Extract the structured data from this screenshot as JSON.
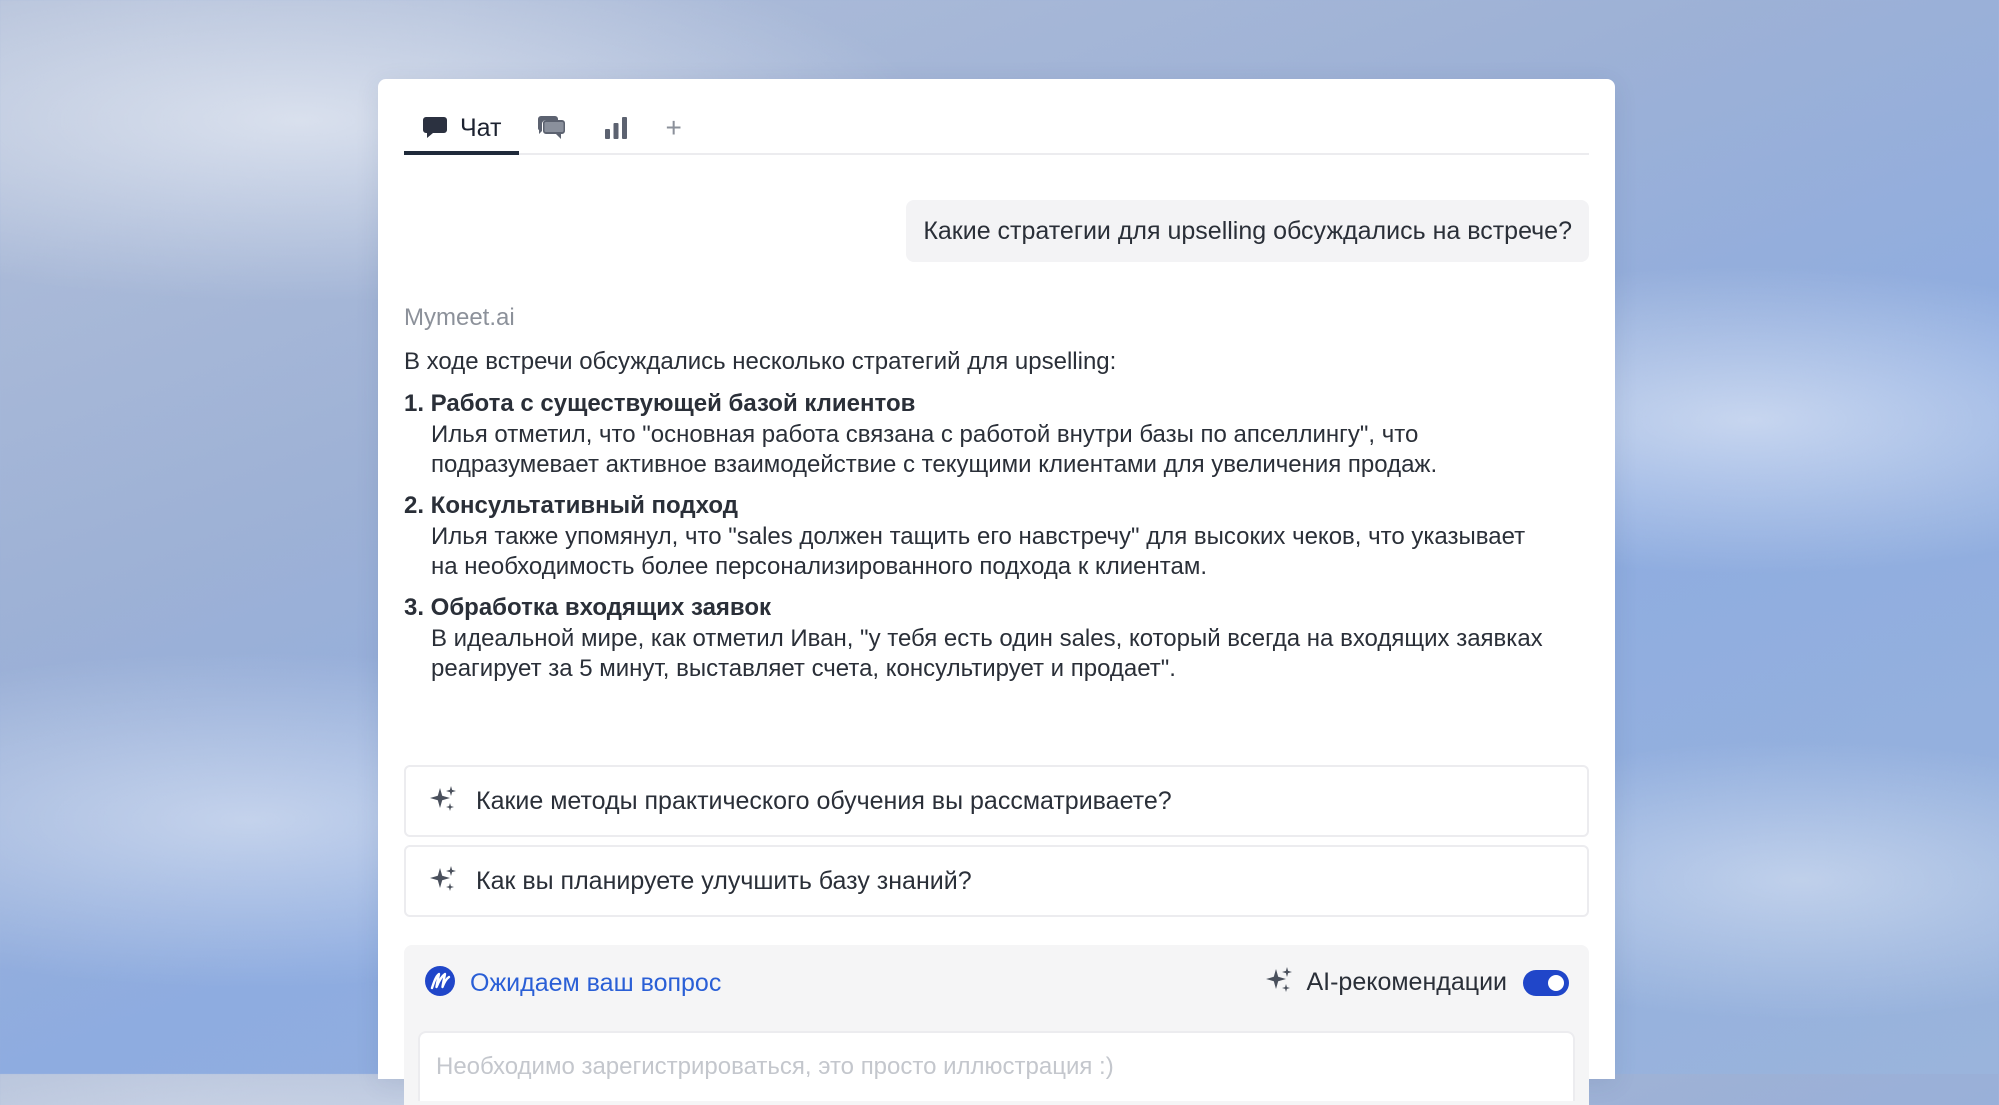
{
  "tabs": {
    "chat_label": "Чат",
    "plus": "+"
  },
  "conversation": {
    "user_question": "Какие стратегии для upselling обсуждались на встрече?",
    "sender": "Mymeet.ai",
    "intro": "В ходе встречи обсуждались несколько стратегий для upselling:",
    "items": [
      {
        "title": "1. Работа с существующей базой клиентов",
        "body": "Илья отметил, что \"основная работа связана с работой внутри базы по апселлингу\", что подразумевает активное взаимодействие с текущими клиентами для увеличения продаж."
      },
      {
        "title": "2. Консультативный подход",
        "body": "Илья также упомянул, что \"sales должен тащить его навстречу\" для высоких чеков, что указывает на необходимость более персонализированного подхода к клиентам."
      },
      {
        "title": "3. Обработка входящих заявок",
        "body": "В идеальной мире, как отметил Иван, \"у тебя есть один sales, который всегда на входящих заявках реагирует за 5 минут, выставляет счета, консультирует и продает\"."
      }
    ]
  },
  "suggestions": [
    {
      "text": "Какие методы практического обучения вы рассматриваете?",
      "icon": "sparkle-icon"
    },
    {
      "text": "Как вы планируете улучшить базу знаний?",
      "icon": "sparkle-icon"
    }
  ],
  "input_panel": {
    "status": "Ожидаем ваш вопрос",
    "ai_label": "AI-рекомендации",
    "ai_enabled": true,
    "placeholder": "Необходимо зарегистрироваться, это просто иллюстрация :)"
  },
  "colors": {
    "accent": "#2046c9",
    "status_text": "#2a5fd6",
    "text": "#2a2f38",
    "muted": "#8c919a"
  }
}
